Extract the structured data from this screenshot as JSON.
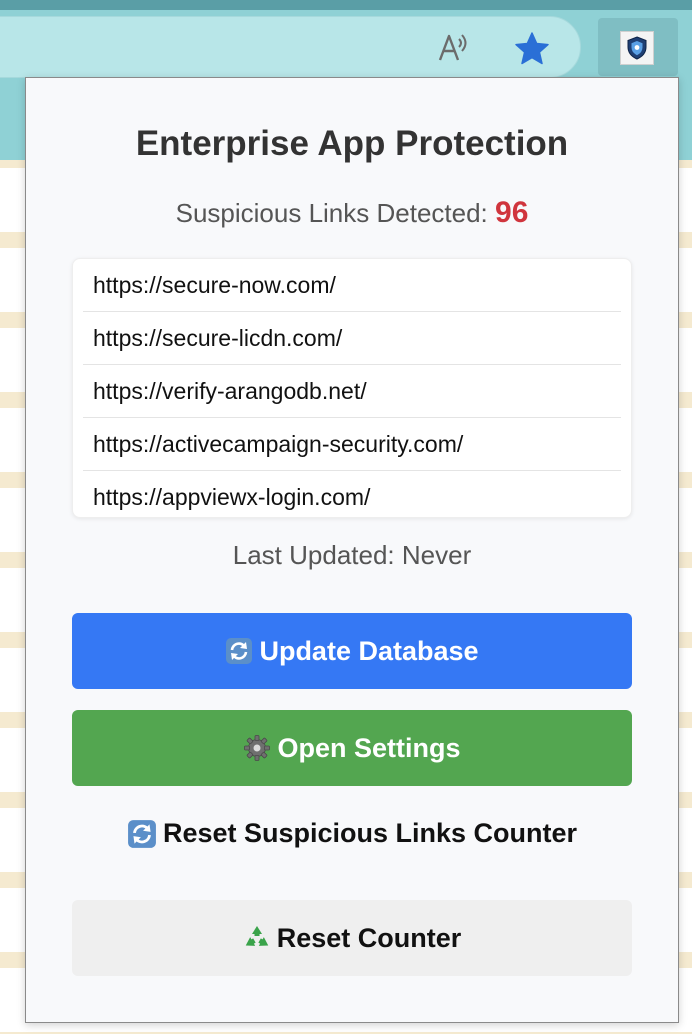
{
  "popup": {
    "title": "Enterprise App Protection",
    "count_label": "Suspicious Links Detected:",
    "count_value": "96",
    "links": [
      "https://secure-now.com/",
      "https://secure-licdn.com/",
      "https://verify-arangodb.net/",
      "https://activecampaign-security.com/",
      "https://appviewx-login.com/"
    ],
    "last_updated": "Last Updated: Never",
    "update_button_label": "Update Database",
    "settings_button_label": "Open Settings",
    "reset_links_heading": "Reset Suspicious Links Counter",
    "reset_counter_button_label": "Reset Counter"
  },
  "icons": {
    "read_aloud": "read-aloud-icon",
    "favorite": "star-icon",
    "extension": "shield-icon",
    "update": "refresh-icon",
    "settings": "gear-icon",
    "reset_links": "refresh-icon",
    "reset_counter": "recycle-icon"
  },
  "colors": {
    "update_button": "#3578f4",
    "settings_button": "#53a650",
    "reset_button": "#efefef",
    "count_value": "#d0353d",
    "favorite_star": "#2a6fd6"
  }
}
